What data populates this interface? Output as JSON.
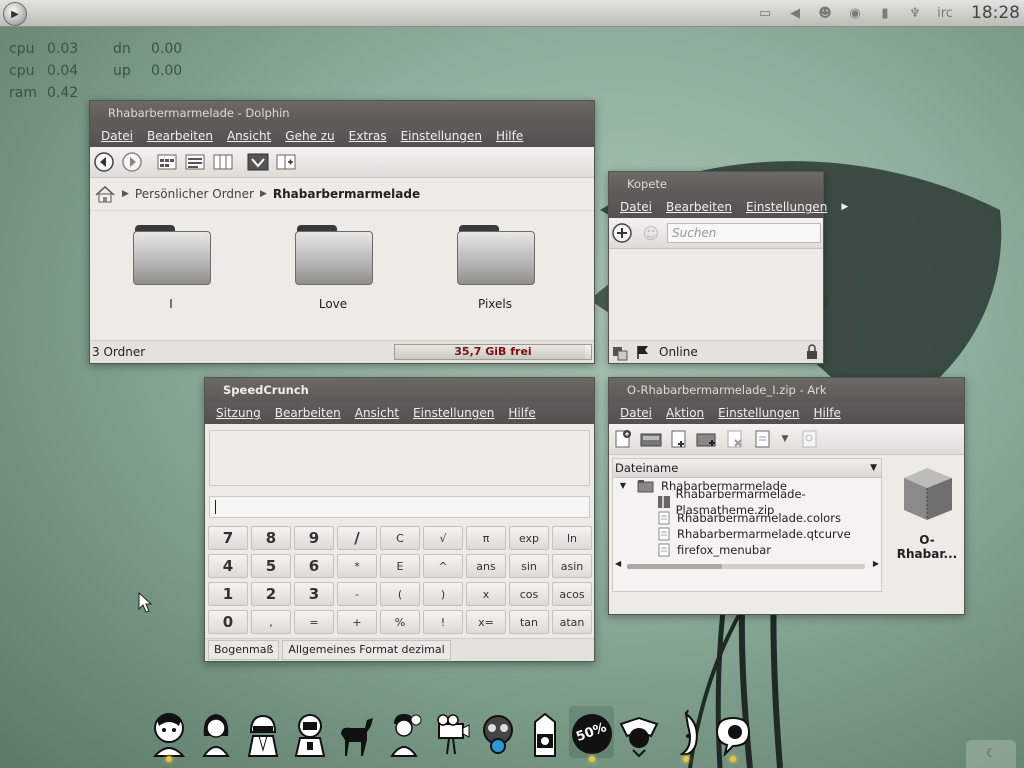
{
  "panel": {
    "clock": "18:28",
    "tray_icons": [
      "notes-icon",
      "volume-icon",
      "network-icon",
      "kopete-tray-icon",
      "battery-icon",
      "usb-icon",
      "irc-icon"
    ]
  },
  "sysmon": [
    {
      "k1": "cpu",
      "v1": "0.03",
      "k2": "dn",
      "v2": "0.00"
    },
    {
      "k1": "cpu",
      "v1": "0.04",
      "k2": "up",
      "v2": "0.00"
    },
    {
      "k1": "ram",
      "v1": "0.42",
      "k2": "",
      "v2": ""
    }
  ],
  "dolphin": {
    "title": "Rhabarbermarmelade - Dolphin",
    "menu": [
      "Datei",
      "Bearbeiten",
      "Ansicht",
      "Gehe zu",
      "Extras",
      "Einstellungen",
      "Hilfe"
    ],
    "breadcrumb": [
      "Persönlicher Ordner",
      "Rhabarbermarmelade"
    ],
    "folders": [
      "I",
      "Love",
      "Pixels"
    ],
    "status": "3 Ordner",
    "free": "35,7 GiB frei",
    "free_fraction": 0.97
  },
  "kopete": {
    "title": "Kopete",
    "menu": [
      "Datei",
      "Bearbeiten",
      "Einstellungen"
    ],
    "search_placeholder": "Suchen",
    "status": "Online"
  },
  "speedcrunch": {
    "title": "SpeedCrunch",
    "menu": [
      "Sitzung",
      "Bearbeiten",
      "Ansicht",
      "Einstellungen",
      "Hilfe"
    ],
    "keys": [
      [
        "7",
        "8",
        "9",
        "/",
        "C",
        "√",
        "π",
        "exp",
        "ln"
      ],
      [
        "4",
        "5",
        "6",
        "*",
        "E",
        "^",
        "ans",
        "sin",
        "asin"
      ],
      [
        "1",
        "2",
        "3",
        "-",
        "(",
        ")",
        "x",
        "cos",
        "acos"
      ],
      [
        "0",
        ",",
        "=",
        "+",
        "%",
        "!",
        "x=",
        "tan",
        "atan"
      ]
    ],
    "status_angle": "Bogenmaß",
    "status_format": "Allgemeines Format dezimal"
  },
  "ark": {
    "title": "O-Rhabarbermarmelade_I.zip - Ark",
    "menu": [
      "Datei",
      "Aktion",
      "Einstellungen",
      "Hilfe"
    ],
    "column": "Dateiname",
    "root": "Rhabarbermarmelade",
    "files": [
      "Rhabarbermarmelade-Plasmatheme.zip",
      "Rhabarbermarmelade.colors",
      "Rhabarbermarmelade.qtcurve",
      "firefox_menubar"
    ],
    "preview_label": "O-Rhabar..."
  },
  "dock": {
    "items": [
      "zombie-avatar-icon",
      "girl-avatar-icon",
      "robot-helmet-icon",
      "robot-helmet-2-icon",
      "deer-icon",
      "nurse-icon",
      "camera-icon",
      "gasmask-icon",
      "milk-carton-icon",
      "sale-badge-icon",
      "eagle-crest-icon",
      "banana-icon",
      "speech-bubble-icon"
    ],
    "sale_text": "50%"
  },
  "colors": {
    "titlebar": "#5a5954",
    "accent_free": "#7a1212",
    "desktop": "#8fb09e"
  }
}
